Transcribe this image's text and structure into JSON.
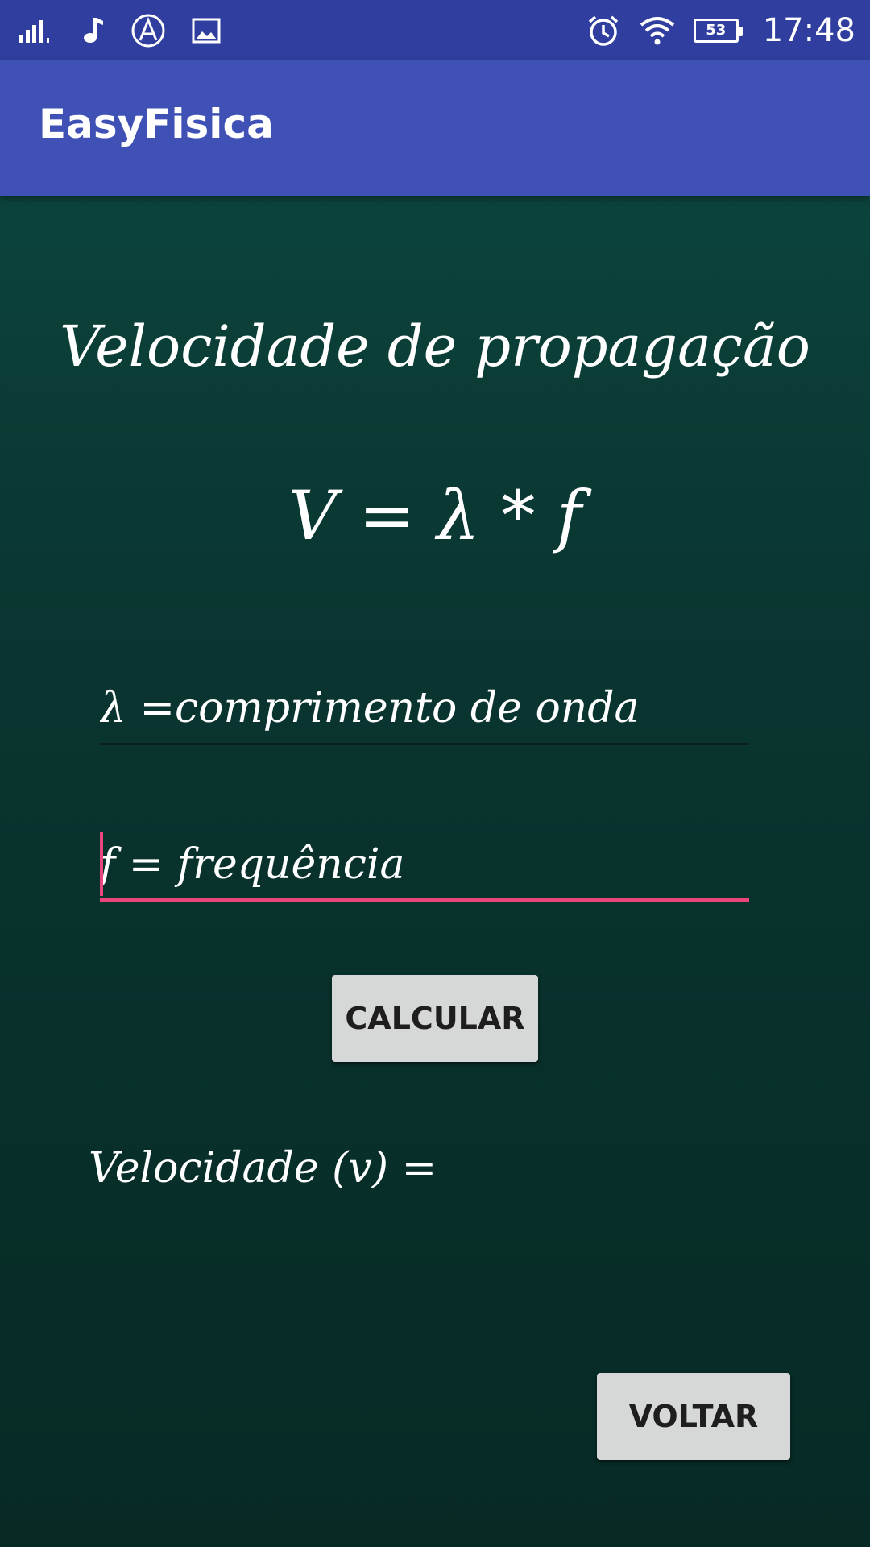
{
  "status_bar": {
    "time": "17:48",
    "battery": "53",
    "left_icons": [
      "signal-icon",
      "music-note-icon",
      "app-a-icon",
      "image-icon"
    ],
    "right_icons": [
      "alarm-icon",
      "wifi-icon",
      "battery-icon"
    ]
  },
  "app_bar": {
    "title": "EasyFisica",
    "color": "#3f51b5",
    "status_color": "#303f9f"
  },
  "main": {
    "heading": "Velocidade de propagação",
    "formula": "V = λ * f",
    "wavelength_placeholder": "λ =comprimento de onda",
    "frequency_placeholder": "f = frequência",
    "calculate_label": "CALCULAR",
    "result_label": "Velocidade (v) =",
    "back_label": "VOLTAR",
    "accent_color": "#e8467c"
  }
}
